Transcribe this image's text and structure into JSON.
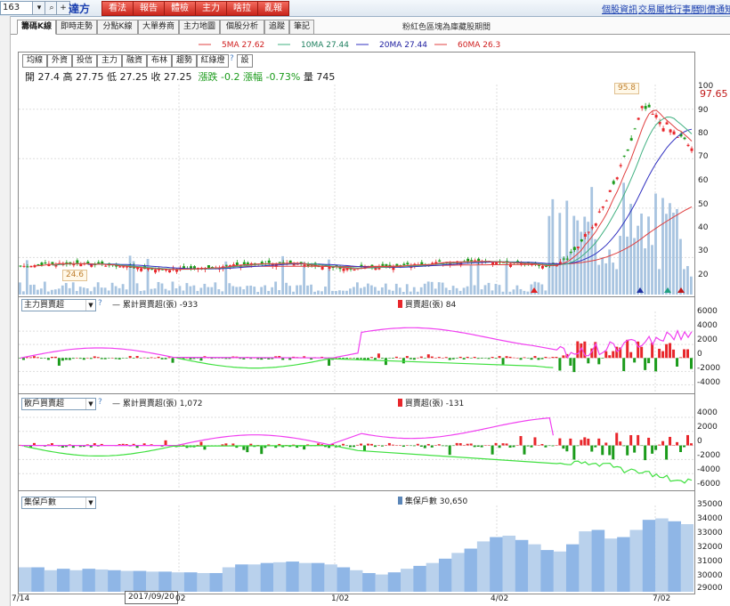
{
  "toolbar": {
    "stock_code": "163",
    "stock_name": "達方",
    "buttons": [
      "看法",
      "報告",
      "體檢",
      "主力",
      "啥拉",
      "亂報"
    ],
    "links": [
      "個股資訊",
      "交易屬性",
      "行事曆",
      "到價通知"
    ]
  },
  "tabs": [
    "籌碼K線",
    "即時走勢",
    "分點K線",
    "大單券商",
    "主力地圖",
    "個股分析",
    "追蹤",
    "筆記"
  ],
  "notice": "粉紅色區塊為庫藏股期間",
  "ma_legend": [
    "5MA 27.62",
    "10MA 27.44",
    "20MA 27.44",
    "60MA 26.3"
  ],
  "ind_buttons": [
    "均線",
    "外資",
    "投信",
    "主力",
    "融資",
    "布林",
    "趨勢",
    "紅綠燈",
    "?",
    "設"
  ],
  "ohlc": {
    "open_label": "開",
    "open": "27.4",
    "high_label": "高",
    "high": "27.75",
    "low_label": "低",
    "low": "27.25",
    "close_label": "收",
    "close": "27.25",
    "change_label": "漲跌",
    "change": "-0.2",
    "pct_label": "漲幅",
    "pct": "-0.73%",
    "vol_label": "量",
    "vol": "745"
  },
  "price_panel": {
    "current": "97.65",
    "high_tag": "95.8",
    "low_tag": "24.6",
    "ticks": [
      "100",
      "90",
      "80",
      "70",
      "60",
      "50",
      "40",
      "30",
      "20"
    ]
  },
  "main_force": {
    "select": "主力買賣超",
    "help": "?",
    "cum_label": "累計買賣超(張) -933",
    "net_label": "買賣超(張) 84",
    "ticks": [
      "6000",
      "4000",
      "2000",
      "0",
      "-2000",
      "-4000"
    ]
  },
  "retail": {
    "select": "散戶買賣超",
    "cum_label": "累計買賣超(張) 1,072",
    "net_label": "買賣超(張) -131",
    "ticks": [
      "4000",
      "2000",
      "0",
      "-2000",
      "-4000",
      "-6000"
    ]
  },
  "holders": {
    "select": "集保戶數",
    "label": "集保戶數 30,650",
    "ticks": [
      "35000",
      "34000",
      "33000",
      "32000",
      "31000",
      "30000",
      "29000"
    ]
  },
  "xaxis": [
    "7/14",
    "2017/09/20",
    "02",
    "1/02",
    "4/02",
    "7/02"
  ],
  "chart_data": [
    {
      "type": "line",
      "title": "",
      "series": [
        {
          "name": "5MA",
          "values": [
            27.62
          ]
        },
        {
          "name": "10MA",
          "values": [
            27.44
          ]
        },
        {
          "name": "20MA",
          "values": [
            27.44
          ]
        },
        {
          "name": "60MA",
          "values": [
            26.3
          ]
        }
      ],
      "ylim": [
        15,
        100
      ],
      "close": 27.25,
      "max": 95.8,
      "min": 24.6
    },
    {
      "type": "bar",
      "title": "",
      "series": [
        {
          "name": "買賣超(張)",
          "values": [
            84
          ]
        },
        {
          "name": "累計買賣超(張)",
          "values": [
            -933
          ]
        }
      ],
      "ylim": [
        -5000,
        6000
      ]
    },
    {
      "type": "bar",
      "title": "",
      "series": [
        {
          "name": "買賣超(張)",
          "values": [
            -131
          ]
        },
        {
          "name": "累計買賣超(張)",
          "values": [
            1072
          ]
        }
      ],
      "ylim": [
        -6000,
        4500
      ]
    },
    {
      "type": "area",
      "title": "",
      "series": [
        {
          "name": "集保戶數",
          "values": [
            30650
          ]
        }
      ],
      "ylim": [
        29000,
        35000
      ]
    }
  ],
  "colors": {
    "up": "#e8262b",
    "down": "#1b9b1b",
    "ma5": "#e04040",
    "ma10": "#40b080",
    "ma20": "#3030c0",
    "ma60": "#e04040",
    "pink": "#f040f0",
    "green": "#40e040",
    "blue": "#8fb6e6"
  }
}
